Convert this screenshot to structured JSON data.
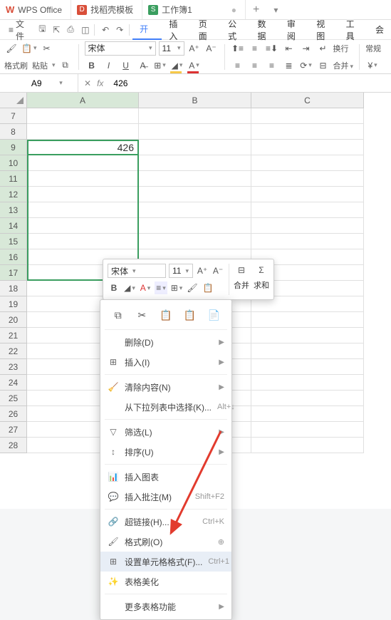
{
  "titlebar": {
    "tabs": [
      {
        "icon": "wps",
        "label": "WPS Office"
      },
      {
        "icon": "pdf",
        "label": "找稻壳模板"
      },
      {
        "icon": "xls",
        "label": "工作簿1",
        "dirty": true,
        "active": true
      }
    ]
  },
  "menubar": {
    "file_label": "文件",
    "items": [
      "开始",
      "插入",
      "页面",
      "公式",
      "数据",
      "审阅",
      "视图",
      "工具",
      "会"
    ],
    "active_index": 0
  },
  "ribbon": {
    "format_painter": "格式刷",
    "paste": "粘贴",
    "font_name": "宋体",
    "font_size": "11",
    "wrap_text": "换行",
    "style_general": "常规",
    "bold": "B",
    "italic": "I",
    "underline": "U",
    "strike": "A"
  },
  "formula": {
    "cell_ref": "A9",
    "value": "426"
  },
  "grid": {
    "columns": [
      "A",
      "B",
      "C"
    ],
    "visible_rows": [
      7,
      8,
      9,
      10,
      11,
      12,
      13,
      14,
      15,
      16,
      17,
      18,
      19,
      20,
      21,
      22,
      23,
      24,
      25,
      26,
      27,
      28
    ],
    "active_cell": "A9",
    "selection": "A9:A17",
    "cells": {
      "A9": "426"
    }
  },
  "minitb": {
    "font_name": "宋体",
    "font_size": "11",
    "merge": "合并",
    "sum": "求和"
  },
  "ctxmenu": {
    "items": [
      {
        "type": "iconrow",
        "icons": [
          "copy",
          "cut",
          "paste",
          "paste-special",
          "clipboard"
        ]
      },
      {
        "type": "sep"
      },
      {
        "label": "删除(D)",
        "icon": "",
        "arrow": true
      },
      {
        "label": "插入(I)",
        "icon": "insert",
        "arrow": true
      },
      {
        "type": "sep"
      },
      {
        "label": "清除内容(N)",
        "icon": "clear",
        "arrow": true
      },
      {
        "label": "从下拉列表中选择(K)...",
        "icon": "",
        "shortcut": "Alt+↓"
      },
      {
        "type": "sep"
      },
      {
        "label": "筛选(L)",
        "icon": "filter",
        "arrow": true
      },
      {
        "label": "排序(U)",
        "icon": "sort",
        "arrow": true
      },
      {
        "type": "sep"
      },
      {
        "label": "插入图表",
        "icon": "chart"
      },
      {
        "label": "插入批注(M)",
        "icon": "comment",
        "shortcut": "Shift+F2"
      },
      {
        "type": "sep"
      },
      {
        "label": "超链接(H)...",
        "icon": "link",
        "shortcut": "Ctrl+K"
      },
      {
        "label": "格式刷(O)",
        "icon": "brush",
        "extra": true
      },
      {
        "label": "设置单元格格式(F)...",
        "icon": "format",
        "shortcut": "Ctrl+1",
        "hover": true
      },
      {
        "label": "表格美化",
        "icon": "beautify"
      },
      {
        "type": "sep"
      },
      {
        "label": "更多表格功能",
        "icon": "",
        "arrow": true
      }
    ]
  },
  "colors": {
    "accent_green": "#3a9e5f",
    "accent_blue": "#417ff9",
    "annotation_red": "#e23b2e"
  }
}
